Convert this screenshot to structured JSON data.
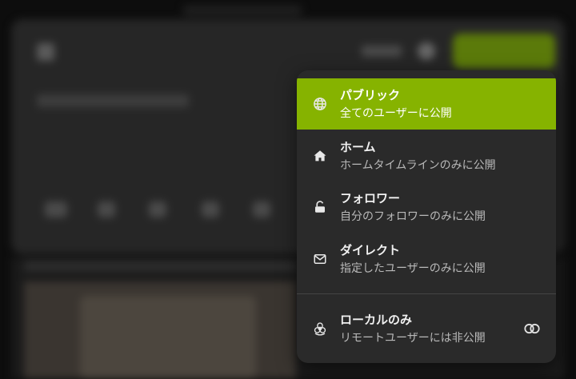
{
  "visibility_menu": {
    "items": [
      {
        "id": "public",
        "icon": "globe-icon",
        "title": "パブリック",
        "description": "全てのユーザーに公開",
        "selected": true
      },
      {
        "id": "home",
        "icon": "home-icon",
        "title": "ホーム",
        "description": "ホームタイムラインのみに公開",
        "selected": false
      },
      {
        "id": "followers",
        "icon": "unlock-icon",
        "title": "フォロワー",
        "description": "自分のフォロワーのみに公開",
        "selected": false
      },
      {
        "id": "specified",
        "icon": "envelope-icon",
        "title": "ダイレクト",
        "description": "指定したユーザーのみに公開",
        "selected": false
      }
    ],
    "local_only": {
      "icon": "biohazard-icon",
      "title": "ローカルのみ",
      "description": "リモートユーザーには非公開",
      "toggle_icon": "toggle-off-icon",
      "enabled": false
    }
  },
  "colors": {
    "accent": "#86b300",
    "menu_bg": "#2a2a2a"
  }
}
